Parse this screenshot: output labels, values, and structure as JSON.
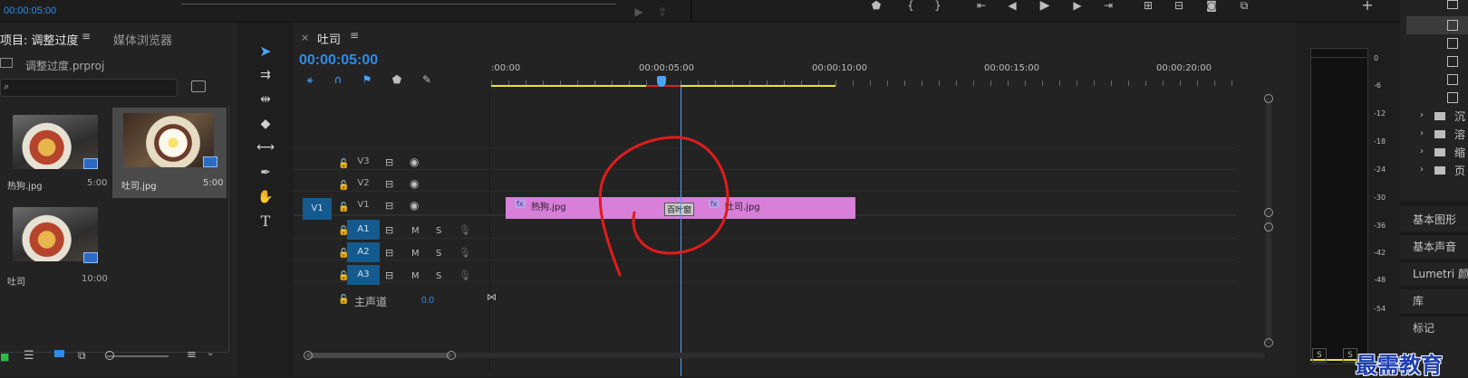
{
  "top_bar": {
    "timecode": "00:00:05:00"
  },
  "project_panel": {
    "tab_active": "项目: 调整过度",
    "tab_other": "媒体浏览器",
    "file_name": "调整过度.prproj",
    "search_placeholder": "",
    "items": [
      {
        "name": "热狗.jpg",
        "duration": "5:00"
      },
      {
        "name": "吐司.jpg",
        "duration": "5:00"
      },
      {
        "name": "吐司",
        "duration": "10:00"
      }
    ]
  },
  "timeline": {
    "tab_title": "吐司",
    "timecode": "00:00:05:00",
    "ruler_labels": [
      ":00:00",
      "00:00:05:00",
      "00:00:10:00",
      "00:00:15:00",
      "00:00:20:00"
    ],
    "video_tracks": [
      {
        "patch": "",
        "name": "V3"
      },
      {
        "patch": "",
        "name": "V2"
      },
      {
        "patch": "V1",
        "name": "V1"
      }
    ],
    "audio_tracks": [
      {
        "name": "A1",
        "m": "M",
        "s": "S"
      },
      {
        "name": "A2",
        "m": "M",
        "s": "S"
      },
      {
        "name": "A3",
        "m": "M",
        "s": "S"
      }
    ],
    "master": {
      "label": "主声道",
      "value": "0.0"
    },
    "clips": [
      {
        "fx": "fx",
        "name": "热狗.jpg"
      },
      {
        "fx": "fx",
        "name": "吐司.jpg"
      }
    ],
    "transition_label": "百叶窗"
  },
  "meter": {
    "scale": [
      "0",
      "-6",
      "-12",
      "-18",
      "-24",
      "-30",
      "-36",
      "-42",
      "-48",
      "-54"
    ],
    "solo_labels": [
      "S",
      "S"
    ]
  },
  "right_panel": {
    "folders": [
      "沉",
      "溶",
      "缩",
      "页"
    ],
    "panels": [
      "基本图形",
      "基本声音",
      "Lumetri 颜色",
      "库",
      "标记"
    ]
  },
  "watermark": "最需教育",
  "colors": {
    "accent": "#2d8ceb",
    "clip": "#d77fd9",
    "annotation": "#e01c1c"
  }
}
